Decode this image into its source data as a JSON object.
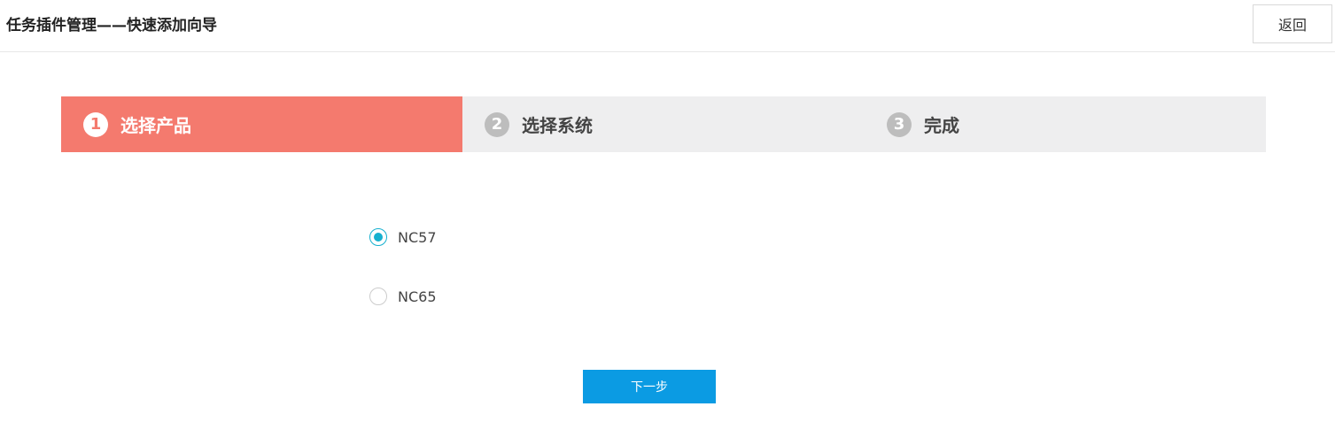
{
  "header": {
    "title": "任务插件管理——快速添加向导",
    "back_label": "返回"
  },
  "steps": [
    {
      "number": "1",
      "label": "选择产品",
      "active": true
    },
    {
      "number": "2",
      "label": "选择系统",
      "active": false
    },
    {
      "number": "3",
      "label": "完成",
      "active": false
    }
  ],
  "product_options": [
    {
      "label": "NC57",
      "checked": true
    },
    {
      "label": "NC65",
      "checked": false
    }
  ],
  "actions": {
    "next_label": "下一步"
  },
  "colors": {
    "active_step": "#f47a6e",
    "inactive_step_bg": "#eeeeef",
    "radio_checked": "#16b0cf",
    "primary_button": "#0b9be3"
  }
}
